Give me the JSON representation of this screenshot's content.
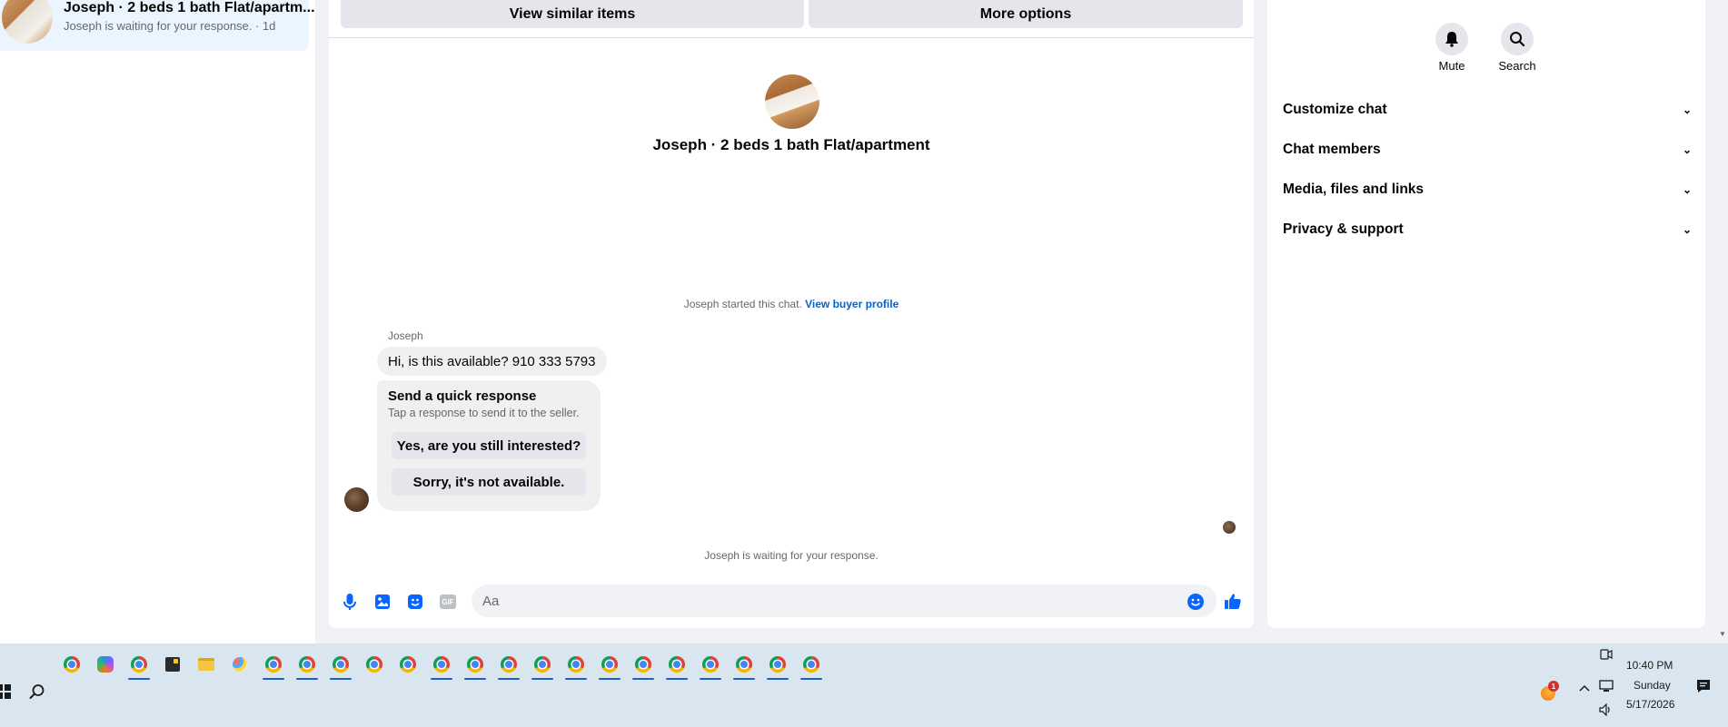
{
  "conversation_list": {
    "active_item": {
      "title": "Joseph · 2 beds 1 bath Flat/apartm...",
      "subtitle": "Joseph is waiting for your response. · 1d"
    }
  },
  "chat": {
    "top_actions": {
      "view_similar": "View similar items",
      "more_options": "More options"
    },
    "header_title": "Joseph · 2 beds 1 bath Flat/apartment",
    "started_text": "Joseph started this chat.",
    "view_buyer_profile": "View buyer profile",
    "sender_name": "Joseph",
    "message": "Hi, is this available? 910 333 5793",
    "quick_response": {
      "title": "Send a quick response",
      "subtitle": "Tap a response to send it to the seller.",
      "option1": "Yes, are you still interested?",
      "option2": "Sorry, it's not available."
    },
    "waiting_text": "Joseph is waiting for your response.",
    "composer": {
      "placeholder": "Aa",
      "icons": [
        "microphone-icon",
        "photo-icon",
        "sticker-icon",
        "gif-icon",
        "emoji-icon",
        "thumbs-up-icon"
      ],
      "gif_label": "GIF"
    }
  },
  "details": {
    "mute_label": "Mute",
    "search_label": "Search",
    "sections": [
      "Customize chat",
      "Chat members",
      "Media, files and links",
      "Privacy & support"
    ]
  },
  "taskbar": {
    "time": "10:40 PM",
    "day": "Sunday",
    "date": "5/17/2026",
    "notification_count": "1"
  },
  "colors": {
    "accent": "#0866ff",
    "link": "#0064d1",
    "active_item_bg": "#ebf5ff",
    "bubble_bg": "#f0f0f0",
    "taskbar_bg": "#d9e6f0"
  }
}
